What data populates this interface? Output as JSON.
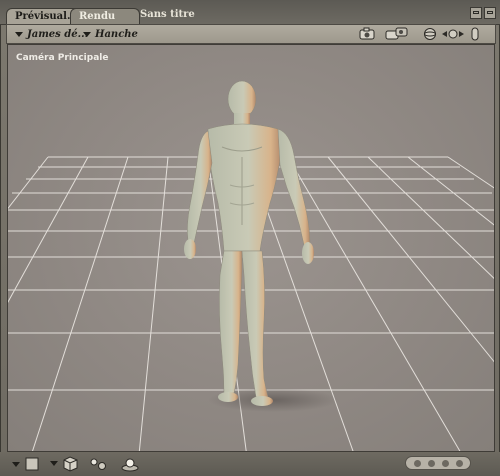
{
  "tabs": [
    {
      "label": "Prévisual.",
      "active": true
    },
    {
      "label": "Rendu",
      "active": false
    }
  ],
  "document_title": "Sans titre",
  "toolbar": {
    "figure_menu": "James dé...",
    "part_menu": "Hanche",
    "icons": [
      "camera-icon",
      "camera-move-icon",
      "trackball-icon",
      "translate-icon",
      "scale-icon"
    ]
  },
  "viewport": {
    "camera_label": "Caméra Principale",
    "background_color": "#918a85",
    "grid_color": "#e7e3df"
  },
  "bottom_bar": {
    "icons": [
      "square-icon",
      "cube-icon",
      "spheres-icon",
      "light-icon"
    ],
    "page_dots": 4
  }
}
